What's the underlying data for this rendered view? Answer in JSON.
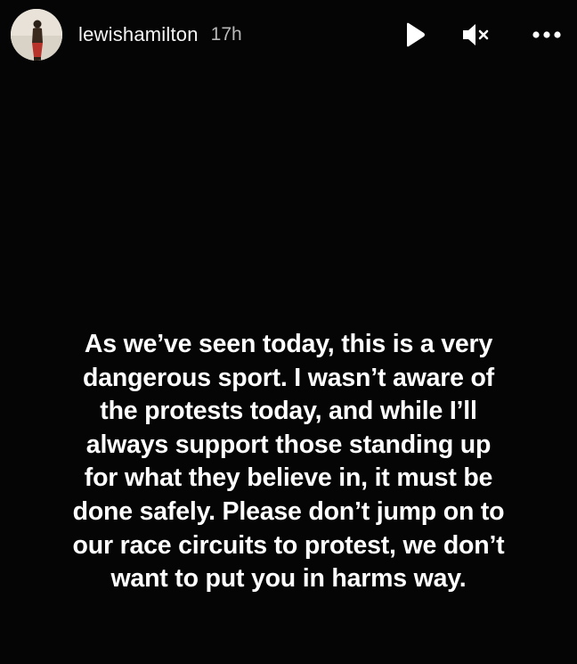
{
  "header": {
    "username": "lewishamilton",
    "timestamp": "17h",
    "icons": {
      "avatar": "profile-avatar",
      "play": "play-icon",
      "mute": "volume-muted-icon",
      "more": "more-options-icon"
    }
  },
  "caption": {
    "lines": [
      "As we’ve seen today, this is a very",
      "dangerous sport. I wasn’t aware of",
      "the protests today, and while I’ll",
      "always support those standing up",
      "for what they believe in, it must be",
      "done safely. Please don’t jump on to",
      "our race circuits to protest, we don’t",
      "want to put you in harms way."
    ]
  },
  "colors": {
    "background": "#050505",
    "text": "#ffffff",
    "timestamp": "#b8b8b8"
  }
}
